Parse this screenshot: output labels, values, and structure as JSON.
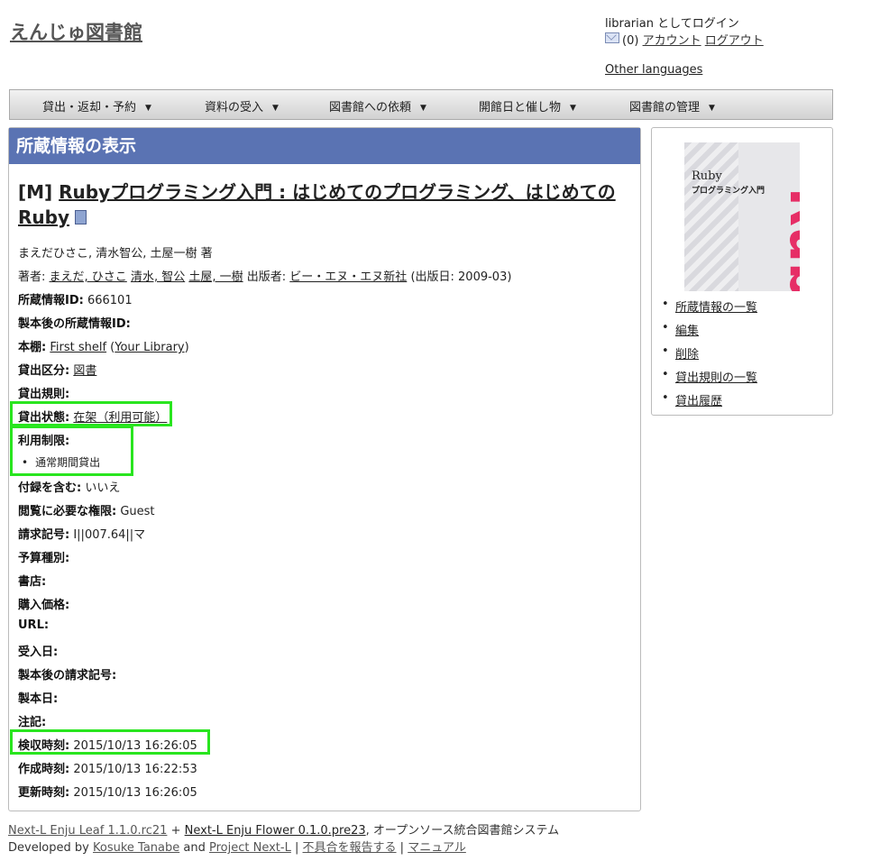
{
  "site_title": "えんじゅ図書館",
  "header": {
    "login_status": "librarian としてログイン",
    "mail_count": "(0)",
    "account_link": "アカウント",
    "logout_link": "ログアウト",
    "other_languages": "Other languages"
  },
  "menu": [
    {
      "label": "貸出・返却・予約",
      "caret": "▼"
    },
    {
      "label": "資料の受入",
      "caret": "▼"
    },
    {
      "label": "図書館への依頼",
      "caret": "▼"
    },
    {
      "label": "開館日と催し物",
      "caret": "▼"
    },
    {
      "label": "図書館の管理",
      "caret": "▼"
    }
  ],
  "panel_title": "所蔵情報の表示",
  "book": {
    "title_prefix": "[M]",
    "title": "Rubyプログラミング入門 : はじめてのプログラミング、はじめてのRuby",
    "responsibility": "まえだひさこ, 清水智公, 土屋一樹 著",
    "creators_label": "著者:",
    "creators": [
      "まえだ, ひさこ",
      "清水, 智公",
      "土屋, 一樹"
    ],
    "publisher_label": "出版者:",
    "publisher": "ビー・エヌ・エヌ新社",
    "pub_date": "(出版日: 2009-03)"
  },
  "fields": {
    "item_id": {
      "label": "所蔵情報ID:",
      "value": "666101"
    },
    "binding_item_id": {
      "label": "製本後の所蔵情報ID:",
      "value": ""
    },
    "shelf": {
      "label": "本棚:",
      "value": "First shelf",
      "library": "Your Library"
    },
    "checkout_type": {
      "label": "貸出区分:",
      "value": "図書"
    },
    "lending_policy": {
      "label": "貸出規則:",
      "value": ""
    },
    "circulation_status": {
      "label": "貸出状態:",
      "value": "在架（利用可能）"
    },
    "use_restriction": {
      "label": "利用制限:",
      "items": [
        "通常期間貸出"
      ]
    },
    "include_supplements": {
      "label": "付録を含む:",
      "value": "いいえ"
    },
    "required_role": {
      "label": "閲覧に必要な権限:",
      "value": "Guest"
    },
    "call_number": {
      "label": "請求記号:",
      "value": "I||007.64||マ"
    },
    "budget_type": {
      "label": "予算種別:",
      "value": ""
    },
    "bookstore": {
      "label": "書店:",
      "value": ""
    },
    "price": {
      "label": "購入価格:",
      "value": ""
    },
    "url": {
      "label": "URL:",
      "value": ""
    },
    "acquired_at": {
      "label": "受入日:",
      "value": ""
    },
    "binding_call_number": {
      "label": "製本後の請求記号:",
      "value": ""
    },
    "binded_at": {
      "label": "製本日:",
      "value": ""
    },
    "note": {
      "label": "注記:",
      "value": ""
    },
    "checked_at": {
      "label": "検収時刻:",
      "value": "2015/10/13 16:26:05"
    },
    "created_at": {
      "label": "作成時刻:",
      "value": "2015/10/13 16:22:53"
    },
    "updated_at": {
      "label": "更新時刻:",
      "value": "2015/10/13 16:26:05"
    }
  },
  "cover": {
    "title_en": "Ruby",
    "title_ja": "プログラミング入門",
    "big_text": "Ruby"
  },
  "side_links": [
    "所蔵情報の一覧",
    "編集",
    "削除",
    "貸出規則の一覧",
    "貸出履歴"
  ],
  "highlight_color": "#29e51f",
  "header_color": "#5a73b3",
  "footer": {
    "leaf": "Next-L Enju Leaf 1.1.0.rc21",
    "plus": "+",
    "flower": "Next-L Enju Flower 0.1.0.pre23",
    "desc": ", オープンソース統合図書館システム",
    "developed_by": "Developed by",
    "author": "Kosuke Tanabe",
    "and": "and",
    "project": "Project Next-L",
    "sep": "|",
    "report": "不具合を報告する",
    "manual": "マニュアル"
  }
}
